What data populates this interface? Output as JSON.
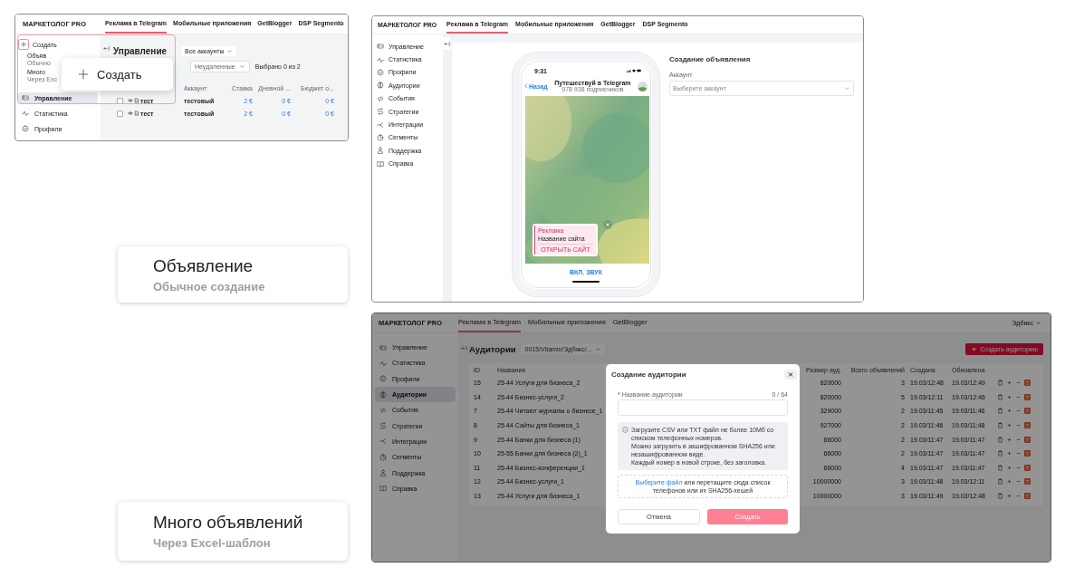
{
  "create_menu_screen": {
    "header": {
      "logo": "МАРКЕТОЛОГ PRO",
      "tabs": [
        {
          "label": "Реклама в Telegram",
          "selected": true
        },
        {
          "label": "Мобильные приложения",
          "selected": false
        },
        {
          "label": "GetBlogger",
          "selected": false
        },
        {
          "label": "DSP Segmento",
          "selected": false
        }
      ]
    },
    "sidebar": {
      "create_label": "Создать",
      "create_options": [
        {
          "title": "Объяв",
          "subtitle": "Обычно"
        },
        {
          "title": "Много",
          "subtitle": "Через Exc"
        }
      ],
      "items": [
        {
          "label": "Управление",
          "selected": true
        },
        {
          "label": "Статистика",
          "selected": false
        },
        {
          "label": "Профили",
          "selected": false
        }
      ]
    },
    "page_title": "Управление",
    "account_filter": "Все аккаунты",
    "status_filter": "Неудаленные",
    "selection_count": "Выбрано 0 из 2",
    "table": {
      "columns": [
        "Аккаунт",
        "Ставка",
        "Дневной ...",
        "Бюджет о..."
      ],
      "rows": [
        {
          "checked": false,
          "name": "тест",
          "account": "тестовый",
          "bid": "2 €",
          "daily": "0 €",
          "budget": "0 €"
        },
        {
          "checked": false,
          "name": "тест",
          "account": "тестовый",
          "bid": "2 €",
          "daily": "0 €",
          "budget": "0 €"
        }
      ]
    },
    "create_popup": {
      "label": "Создать"
    }
  },
  "ad_creation_screen": {
    "header": {
      "logo": "МАРКЕТОЛОГ PRO",
      "tabs": [
        {
          "label": "Реклама в Telegram",
          "selected": true
        },
        {
          "label": "Мобильные приложения",
          "selected": false
        },
        {
          "label": "GetBlogger",
          "selected": false
        },
        {
          "label": "DSP Segmento",
          "selected": false
        }
      ]
    },
    "sidebar": {
      "items": [
        {
          "label": "Управление",
          "selected": false
        },
        {
          "label": "Статистика",
          "selected": false
        },
        {
          "label": "Профили",
          "selected": false
        },
        {
          "label": "Аудитории",
          "selected": false
        },
        {
          "label": "События",
          "selected": false
        },
        {
          "label": "Стратегии",
          "selected": false
        },
        {
          "label": "Интеграции",
          "selected": false
        },
        {
          "label": "Сегменты",
          "selected": false
        },
        {
          "label": "Поддержка",
          "selected": false
        },
        {
          "label": "Справка",
          "selected": false
        }
      ]
    },
    "phone": {
      "time": "9:31",
      "back": "Назад",
      "channel": "Путешествуй в Telegram",
      "subscribers": "978 938 подписчиков",
      "ad": {
        "label": "Реклама",
        "title": "Название сайта",
        "button": "ОТКРЫТЬ САЙТ"
      },
      "sound_button": "ВКЛ. ЗВУК"
    },
    "form": {
      "title": "Создание объявления",
      "account_label": "Аккаунт",
      "account_placeholder": "Выберите аккаунт"
    }
  },
  "audiences_screen": {
    "header": {
      "logo": "МАРКЕТОЛОГ PRO",
      "tabs": [
        {
          "label": "Реклама в Telegram",
          "selected": true
        },
        {
          "label": "Мобильные приложения",
          "selected": false
        },
        {
          "label": "GetBlogger",
          "selected": false
        }
      ]
    },
    "user_menu": "Эдбикс",
    "sidebar": {
      "items": [
        {
          "label": "Управление",
          "selected": false
        },
        {
          "label": "Статистика",
          "selected": false
        },
        {
          "label": "Профили",
          "selected": false
        },
        {
          "label": "Аудитории",
          "selected": true
        },
        {
          "label": "События",
          "selected": false
        },
        {
          "label": "Стратегии",
          "selected": false
        },
        {
          "label": "Интеграции",
          "selected": false
        },
        {
          "label": "Сегменты",
          "selected": false
        },
        {
          "label": "Поддержка",
          "selected": false
        },
        {
          "label": "Справка",
          "selected": false
        }
      ]
    },
    "page_title": "Аудитории",
    "account_filter": "0015/Vitamin/Эдбикс/...",
    "create_button": "Создать аудиторию",
    "table": {
      "columns": [
        "ID",
        "Название",
        "Размер ауд.",
        "Всего объявлений",
        "Создана",
        "Обновлена"
      ],
      "rows": [
        {
          "id": "15",
          "name": "25-44 Услуги для бизнеса_2",
          "size": "820000",
          "ads": "3",
          "created": "19.03/12:48",
          "updated": "19.03/12:49"
        },
        {
          "id": "14",
          "name": "25-44 Бизнес-услуги_2",
          "size": "820000",
          "ads": "5",
          "created": "19.03/12:11",
          "updated": "19.03/12:46"
        },
        {
          "id": "7",
          "name": "25-44 Читают журналы о бизнесе_1",
          "size": "329000",
          "ads": "2",
          "created": "19.03/11:45",
          "updated": "19.03/11:46"
        },
        {
          "id": "8",
          "name": "25-44 Сайты для бизнеса_1",
          "size": "927000",
          "ads": "2",
          "created": "19.03/11:46",
          "updated": "19.03/11:48"
        },
        {
          "id": "9",
          "name": "25-44 Банки для бизнеса (1)",
          "size": "66000",
          "ads": "2",
          "created": "19.03/11:47",
          "updated": "19.03/11:47"
        },
        {
          "id": "10",
          "name": "25-55 Банки для бизнеса (2)_1",
          "size": "66000",
          "ads": "2",
          "created": "19.03/11:47",
          "updated": "19.03/11:47"
        },
        {
          "id": "11",
          "name": "25-44 Бизнес-конференции_1",
          "size": "66000",
          "ads": "4",
          "created": "19.03/11:47",
          "updated": "19.03/11:47"
        },
        {
          "id": "12",
          "name": "25-44 Бизнес-услуги_1",
          "size": "10000000",
          "ads": "3",
          "created": "19.03/11:48",
          "updated": "19.03/12:11"
        },
        {
          "id": "13",
          "name": "25-44 Услуги для бизнеса_1",
          "size": "10000000",
          "ads": "3",
          "created": "19.03/11:49",
          "updated": "19.03/12:48"
        }
      ]
    },
    "modal": {
      "title": "Создание аудитории",
      "required_mark": "*",
      "name_label": "Название аудитории",
      "counter": "0 / 64",
      "info": "Загрузите CSV или TXT файл не более 10Мб со\nсписком телефонных номеров.\nМожно загрузить в зашифрованном SHA256 или\nнезашифрованном виде.\nКаждый номер в новой строке, без заголовка.",
      "upload_link": "Выберите файл",
      "upload_text": "или перетащите сюда список\nтелефонов или их SHA256-хешей",
      "cancel_button": "Отмена",
      "submit_button": "Создать"
    }
  },
  "callouts": [
    {
      "title": "Объявление",
      "subtitle": "Обычное создание"
    },
    {
      "title": "Много объявлений",
      "subtitle": "Через Excel-шаблон"
    }
  ]
}
